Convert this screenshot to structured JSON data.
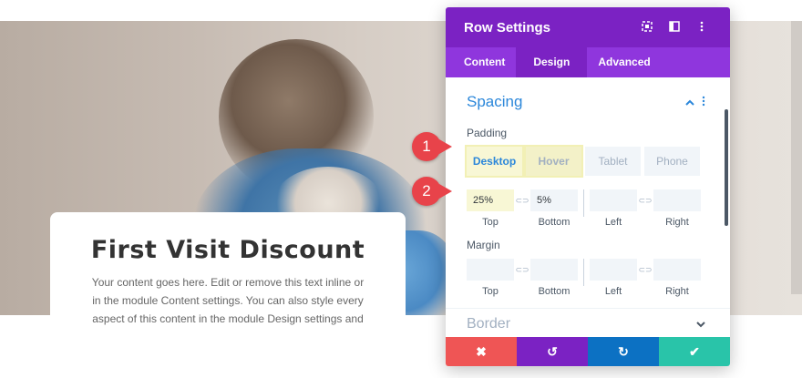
{
  "card": {
    "title": "First Visit Discount",
    "body": "Your content goes here. Edit or remove this text inline or in the module Content settings. You can also style every aspect of this content in the module Design settings and"
  },
  "panel": {
    "title": "Row Settings",
    "header_icons": [
      "focus-icon",
      "sidebar-layout-icon",
      "more-vertical-icon"
    ],
    "tabs": [
      {
        "label": "Content"
      },
      {
        "label": "Design"
      },
      {
        "label": "Advanced"
      }
    ],
    "active_tab": "Design",
    "spacing": {
      "title": "Spacing",
      "padding_label": "Padding",
      "devices": [
        "Desktop",
        "Hover",
        "Tablet",
        "Phone"
      ],
      "padding": {
        "top": "25%",
        "bottom": "5%",
        "left": "",
        "right": ""
      },
      "padding_sublabels": [
        "Top",
        "Bottom",
        "Left",
        "Right"
      ],
      "margin_label": "Margin",
      "margin": {
        "top": "",
        "bottom": "",
        "left": "",
        "right": ""
      },
      "margin_sublabels": [
        "Top",
        "Bottom",
        "Left",
        "Right"
      ],
      "link_glyph": "⊂⊃"
    },
    "border": {
      "title": "Border"
    },
    "footer": {
      "buttons": [
        {
          "name": "cancel",
          "glyph": "✖",
          "color": "#ef5555"
        },
        {
          "name": "undo",
          "glyph": "↺",
          "color": "#7b22c3"
        },
        {
          "name": "redo",
          "glyph": "↻",
          "color": "#0c71c3"
        },
        {
          "name": "save",
          "glyph": "✔",
          "color": "#29c4a9"
        }
      ]
    }
  },
  "callouts": [
    "1",
    "2"
  ],
  "colors": {
    "header": "#7b22c3",
    "tabs": "#8f36dd",
    "accent": "#2b87da",
    "highlight": "#f8f7d5",
    "callout": "#e8434a"
  }
}
